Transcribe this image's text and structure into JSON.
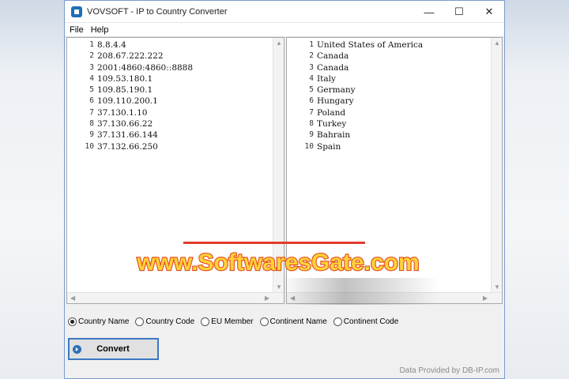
{
  "window": {
    "title": "VOVSOFT - IP to Country Converter",
    "controls": {
      "minimize": "—",
      "maximize": "☐",
      "close": "✕"
    }
  },
  "menu": {
    "file": "File",
    "help": "Help"
  },
  "left_panel": {
    "line_numbers": [
      "1",
      "2",
      "3",
      "4",
      "5",
      "6",
      "7",
      "8",
      "9",
      "10"
    ],
    "lines": [
      "8.8.4.4",
      "208.67.222.222",
      "2001:4860:4860::8888",
      "109.53.180.1",
      "109.85.190.1",
      "109.110.200.1",
      "37.130.1.10",
      "37.130.66.22",
      "37.131.66.144",
      "37.132.66.250"
    ]
  },
  "right_panel": {
    "line_numbers": [
      "1",
      "2",
      "3",
      "4",
      "5",
      "6",
      "7",
      "8",
      "9",
      "10"
    ],
    "lines": [
      "United States of America",
      "Canada",
      "Canada",
      "Italy",
      "Germany",
      "Hungary",
      "Poland",
      "Turkey",
      "Bahrain",
      "Spain"
    ]
  },
  "options": {
    "country_name": "Country Name",
    "country_code": "Country Code",
    "eu_member": "EU Member",
    "continent_name": "Continent Name",
    "continent_code": "Continent Code",
    "selected": "Country Name"
  },
  "convert_button": {
    "label": "Convert"
  },
  "footer": {
    "credit": "Data Provided by DB-IP.com"
  },
  "watermark": {
    "text": "www.SoftwaresGate.com"
  },
  "colors": {
    "accent": "#2c6fb7",
    "watermark_fill": "#ffd23a",
    "watermark_stroke": "#e24a1a"
  }
}
